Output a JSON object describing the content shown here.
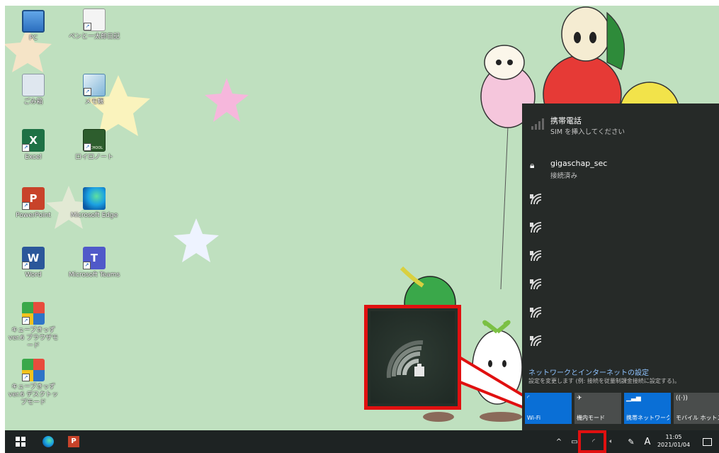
{
  "desktop": {
    "icons": [
      {
        "label": "PC"
      },
      {
        "label": "ペンと一太郎日記"
      },
      {
        "label": "ごみ箱"
      },
      {
        "label": "メモ帳"
      },
      {
        "label": "Excel"
      },
      {
        "label": "ロイロノート"
      },
      {
        "label": "PowerPoint"
      },
      {
        "label": "Microsoft Edge"
      },
      {
        "label": "Word"
      },
      {
        "label": "Microsoft Teams"
      },
      {
        "label": "キューブきっず ver.6 ブラウザモード"
      },
      {
        "label": "キューブきっず ver.6 デスクトップモード"
      }
    ],
    "school_badge": "SCHOOL"
  },
  "network_panel": {
    "cellular": {
      "title": "携帯電話",
      "subtitle": "SIM を挿入してください"
    },
    "connected": {
      "title": "gigaschap_sec",
      "subtitle": "接続済み"
    },
    "settings_link": "ネットワークとインターネットの設定",
    "settings_desc": "設定を変更します (例: 接続を従量制課金接続に設定する)。",
    "tiles": [
      {
        "label": "Wi-Fi",
        "icon": "wifi-icon",
        "active": true
      },
      {
        "label": "機内モード",
        "icon": "airplane-icon",
        "active": false
      },
      {
        "label": "携帯ネットワーク",
        "icon": "cellular-icon",
        "active": true
      },
      {
        "label": "モバイル ホットス ポット",
        "icon": "hotspot-icon",
        "active": false
      }
    ]
  },
  "taskbar": {
    "ime": "A",
    "time": "11:05",
    "date": "2021/01/04"
  },
  "colors": {
    "desktop_bg": "#bfe0bf",
    "panel_bg": "#262a28",
    "accent": "#0a6fd6",
    "highlight": "#e01010"
  }
}
